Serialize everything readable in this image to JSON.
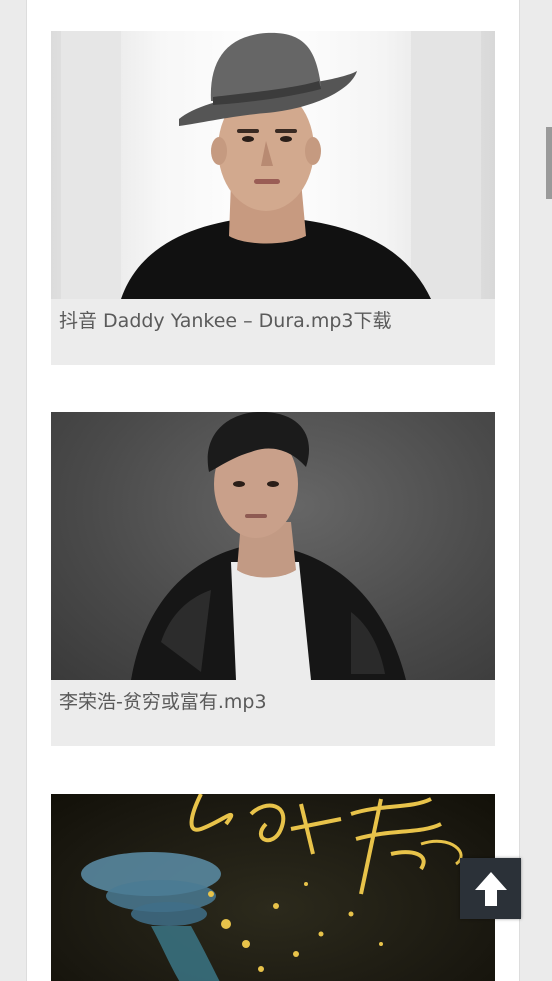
{
  "posts": [
    {
      "title": "抖音 Daddy Yankee – Dura.mp3下载",
      "image": "daddy-yankee-photo"
    },
    {
      "title": "李荣浩-贫穷或富有.mp3",
      "image": "li-ronghao-photo"
    },
    {
      "title": "",
      "image": "album-artwork"
    }
  ],
  "colors": {
    "page_background": "#ebebeb",
    "card_background": "#ececec",
    "title_text": "#5a5a5a",
    "back_to_top_bg": "#2b3138"
  },
  "icons": {
    "back_to_top": "arrow-up-icon"
  }
}
